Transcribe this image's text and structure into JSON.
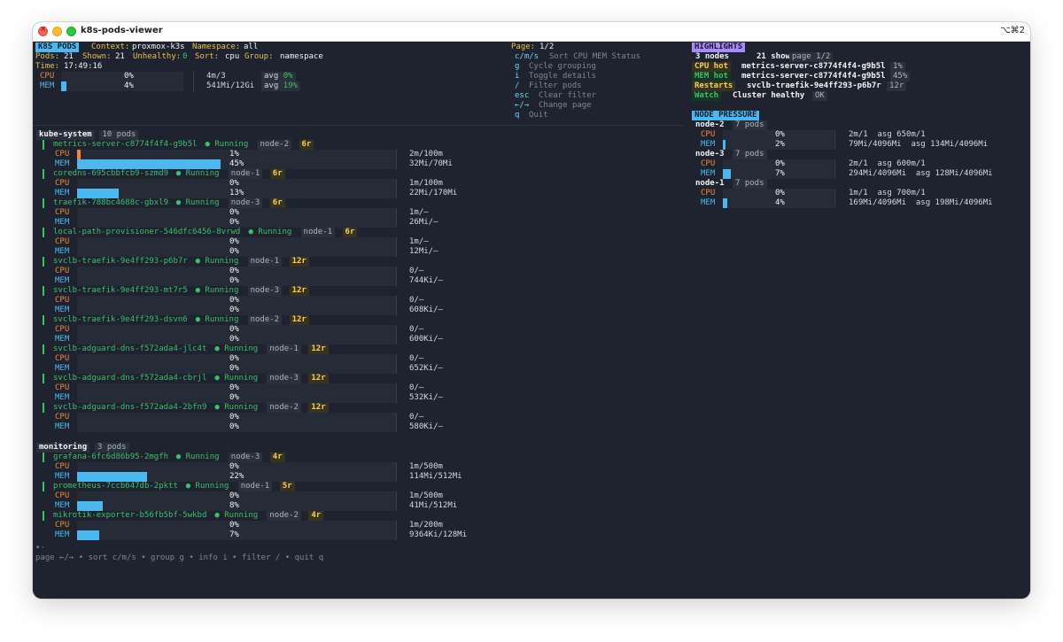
{
  "window": {
    "title": "k8s-pods-viewer",
    "shortcut": "⌥⌘2",
    "close_glyph": "×"
  },
  "header": {
    "app_badge": "K8S PODS",
    "context_label": "Context:",
    "context_value": "proxmox-k3s",
    "namespace_label": "Namespace:",
    "namespace_value": "all",
    "pods_label": "Pods:",
    "pods_value": "21",
    "shown_label": "Shown:",
    "shown_value": "21",
    "unhealthy_label": "Unhealthy:",
    "unhealthy_value": "0",
    "sort_label": "Sort:",
    "sort_value": "cpu",
    "group_label": "Group:",
    "group_value": "namespace",
    "time_label": "Time:",
    "time_value": "17:49:16"
  },
  "summary": {
    "cpu": {
      "label": "CPU",
      "pct": "0%",
      "fill": 0,
      "usage": "4m/3",
      "avg_label": "avg",
      "avg_value": "0%"
    },
    "mem": {
      "label": "MEM",
      "pct": "4%",
      "fill": 4,
      "usage": "541Mi/12Gi",
      "avg_label": "avg",
      "avg_value": "19%"
    }
  },
  "help": {
    "page_label": "Page:",
    "page_value": "1/2",
    "keys": [
      {
        "key": "c/m/s",
        "desc": "Sort CPU MEM Status"
      },
      {
        "key": "g",
        "desc": "Cycle grouping"
      },
      {
        "key": "i",
        "desc": "Toggle details"
      },
      {
        "key": "/",
        "desc": "Filter pods"
      },
      {
        "key": "esc",
        "desc": "Clear filter"
      },
      {
        "key": "←/→",
        "desc": "Change page"
      },
      {
        "key": "q",
        "desc": "Quit"
      }
    ]
  },
  "highlights": {
    "title": "HIGHLIGHTS",
    "nodes": "3 nodes",
    "shown": "21 shown",
    "page": "page 1/2",
    "rows": [
      {
        "label": "CPU hot",
        "name": "metrics-server-c8774f4f4-g9b5l",
        "value": "1%"
      },
      {
        "label": "MEM hot",
        "name": "metrics-server-c8774f4f4-g9b5l",
        "value": "45%"
      },
      {
        "label": "Restarts",
        "name": "svclb-traefik-9e4ff293-p6b7r",
        "value": "12r"
      },
      {
        "label": "Watch",
        "name": "Cluster healthy",
        "value": "OK"
      }
    ]
  },
  "node_pressure": {
    "title": "NODE PRESSURE",
    "nodes": [
      {
        "name": "node-2",
        "pods": "7 pods",
        "cpu_pct": "0%",
        "cpu_fill": 0,
        "cpu_usage": "2m/1  asg 650m/1",
        "mem_pct": "2%",
        "mem_fill": 2,
        "mem_usage": "79Mi/4096Mi  asg 134Mi/4096Mi"
      },
      {
        "name": "node-3",
        "pods": "7 pods",
        "cpu_pct": "0%",
        "cpu_fill": 0,
        "cpu_usage": "2m/1  asg 600m/1",
        "mem_pct": "7%",
        "mem_fill": 7,
        "mem_usage": "294Mi/4096Mi  asg 128Mi/4096Mi"
      },
      {
        "name": "node-1",
        "pods": "7 pods",
        "cpu_pct": "0%",
        "cpu_fill": 0,
        "cpu_usage": "1m/1  asg 700m/1",
        "mem_pct": "4%",
        "mem_fill": 4,
        "mem_usage": "169Mi/4096Mi  asg 198Mi/4096Mi"
      }
    ]
  },
  "groups": [
    {
      "name": "kube-system",
      "count": "10 pods",
      "pods": [
        {
          "name": "metrics-server-c8774f4f4-g9b5l",
          "status": "● Running",
          "node": "node-2",
          "restarts": "6r",
          "cpu_pct": "1%",
          "cpu_fill": 1,
          "cpu_usage": "2m/100m",
          "mem_pct": "45%",
          "mem_fill": 45,
          "mem_usage": "32Mi/70Mi"
        },
        {
          "name": "coredns-695cbbfcb9-szmd9",
          "status": "● Running",
          "node": "node-1",
          "restarts": "6r",
          "cpu_pct": "0%",
          "cpu_fill": 0,
          "cpu_usage": "1m/100m",
          "mem_pct": "13%",
          "mem_fill": 13,
          "mem_usage": "22Mi/170Mi"
        },
        {
          "name": "traefik-788bc4688c-gbxl9",
          "status": "● Running",
          "node": "node-3",
          "restarts": "6r",
          "cpu_pct": "0%",
          "cpu_fill": 0,
          "cpu_usage": "1m/–",
          "mem_pct": "0%",
          "mem_fill": 0,
          "mem_usage": "26Mi/–"
        },
        {
          "name": "local-path-provisioner-546dfc6456-8vrwd",
          "status": "● Running",
          "node": "node-1",
          "restarts": "6r",
          "cpu_pct": "0%",
          "cpu_fill": 0,
          "cpu_usage": "1m/–",
          "mem_pct": "0%",
          "mem_fill": 0,
          "mem_usage": "12Mi/–"
        },
        {
          "name": "svclb-traefik-9e4ff293-p6b7r",
          "status": "● Running",
          "node": "node-1",
          "restarts": "12r",
          "cpu_pct": "0%",
          "cpu_fill": 0,
          "cpu_usage": "0/–",
          "mem_pct": "0%",
          "mem_fill": 0,
          "mem_usage": "744Ki/–"
        },
        {
          "name": "svclb-traefik-9e4ff293-mt7r5",
          "status": "● Running",
          "node": "node-3",
          "restarts": "12r",
          "cpu_pct": "0%",
          "cpu_fill": 0,
          "cpu_usage": "0/–",
          "mem_pct": "0%",
          "mem_fill": 0,
          "mem_usage": "608Ki/–"
        },
        {
          "name": "svclb-traefik-9e4ff293-dsvn6",
          "status": "● Running",
          "node": "node-2",
          "restarts": "12r",
          "cpu_pct": "0%",
          "cpu_fill": 0,
          "cpu_usage": "0/–",
          "mem_pct": "0%",
          "mem_fill": 0,
          "mem_usage": "600Ki/–"
        },
        {
          "name": "svclb-adguard-dns-f572ada4-jlc4t",
          "status": "● Running",
          "node": "node-1",
          "restarts": "12r",
          "cpu_pct": "0%",
          "cpu_fill": 0,
          "cpu_usage": "0/–",
          "mem_pct": "0%",
          "mem_fill": 0,
          "mem_usage": "652Ki/–"
        },
        {
          "name": "svclb-adguard-dns-f572ada4-cbrjl",
          "status": "● Running",
          "node": "node-3",
          "restarts": "12r",
          "cpu_pct": "0%",
          "cpu_fill": 0,
          "cpu_usage": "0/–",
          "mem_pct": "0%",
          "mem_fill": 0,
          "mem_usage": "532Ki/–"
        },
        {
          "name": "svclb-adguard-dns-f572ada4-2bfn9",
          "status": "● Running",
          "node": "node-2",
          "restarts": "12r",
          "cpu_pct": "0%",
          "cpu_fill": 0,
          "cpu_usage": "0/–",
          "mem_pct": "0%",
          "mem_fill": 0,
          "mem_usage": "580Ki/–"
        }
      ]
    },
    {
      "name": "monitoring",
      "count": "3 pods",
      "pods": [
        {
          "name": "grafana-6fc6d86b95-2mgfh",
          "status": "● Running",
          "node": "node-3",
          "restarts": "4r",
          "cpu_pct": "0%",
          "cpu_fill": 0,
          "cpu_usage": "1m/500m",
          "mem_pct": "22%",
          "mem_fill": 22,
          "mem_usage": "114Mi/512Mi"
        },
        {
          "name": "prometheus-7ccb647db-2pktt",
          "status": "● Running",
          "node": "node-1",
          "restarts": "5r",
          "cpu_pct": "0%",
          "cpu_fill": 0,
          "cpu_usage": "1m/500m",
          "mem_pct": "8%",
          "mem_fill": 8,
          "mem_usage": "41Mi/512Mi"
        },
        {
          "name": "mikrotik-exporter-b56fb5bf-5wkbd",
          "status": "● Running",
          "node": "node-2",
          "restarts": "4r",
          "cpu_pct": "0%",
          "cpu_fill": 0,
          "cpu_usage": "1m/200m",
          "mem_pct": "7%",
          "mem_fill": 7,
          "mem_usage": "9364Ki/128Mi"
        }
      ]
    }
  ],
  "footer": {
    "ellipsis": "•·",
    "hints": "page ←/→ • sort c/m/s • group g • info i • filter / • quit q"
  },
  "colors": {
    "cpu": "#f0883e",
    "mem": "#4bb8f0",
    "running": "#3fbf6a",
    "badge_bg": "#4bb8f0",
    "highlight_badge_bg": "#a78bfa",
    "restart_bg": "#3a3220",
    "restart_fg": "#f2d35a"
  }
}
